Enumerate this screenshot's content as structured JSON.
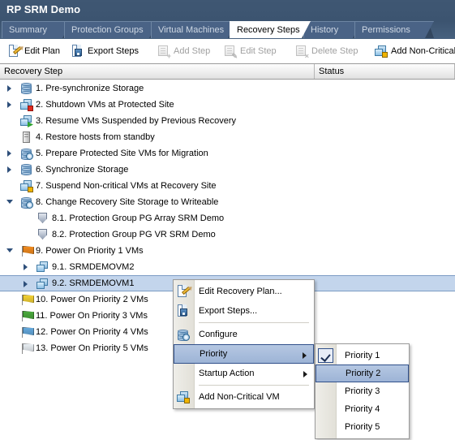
{
  "window": {
    "title": "RP SRM Demo"
  },
  "tabs": [
    {
      "label": "Summary",
      "selected": false
    },
    {
      "label": "Protection Groups",
      "selected": false
    },
    {
      "label": "Virtual Machines",
      "selected": false
    },
    {
      "label": "Recovery Steps",
      "selected": true
    },
    {
      "label": "History",
      "selected": false
    },
    {
      "label": "Permissions",
      "selected": false
    }
  ],
  "toolbar": [
    {
      "label": "Edit Plan",
      "icon": "edit-plan-icon",
      "enabled": true
    },
    {
      "label": "Export Steps",
      "icon": "export-steps-icon",
      "enabled": true
    },
    {
      "label": "Add Step",
      "icon": "add-step-icon",
      "enabled": false
    },
    {
      "label": "Edit Step",
      "icon": "edit-step-icon",
      "enabled": false
    },
    {
      "label": "Delete Step",
      "icon": "delete-step-icon",
      "enabled": false
    },
    {
      "label": "Add Non-Critical",
      "icon": "add-non-critical-icon",
      "enabled": true
    }
  ],
  "columns": [
    {
      "label": "Recovery Step"
    },
    {
      "label": "Status"
    }
  ],
  "rows": [
    {
      "label": "1. Pre-synchronize Storage",
      "indent": 0,
      "twisty": "collapsed",
      "icon": "storage-icon"
    },
    {
      "label": "2. Shutdown VMs at Protected Site",
      "indent": 0,
      "twisty": "collapsed",
      "icon": "vms-stop-icon"
    },
    {
      "label": "3. Resume VMs Suspended by Previous Recovery",
      "indent": 0,
      "twisty": "none",
      "icon": "vms-resume-icon"
    },
    {
      "label": "4. Restore hosts from standby",
      "indent": 0,
      "twisty": "none",
      "icon": "host-icon"
    },
    {
      "label": "5. Prepare Protected Site VMs for Migration",
      "indent": 0,
      "twisty": "collapsed",
      "icon": "storage-config-icon"
    },
    {
      "label": "6. Synchronize Storage",
      "indent": 0,
      "twisty": "collapsed",
      "icon": "storage-icon"
    },
    {
      "label": "7. Suspend Non-critical VMs at Recovery Site",
      "indent": 0,
      "twisty": "none",
      "icon": "vms-suspend-icon"
    },
    {
      "label": "8. Change Recovery Site Storage to Writeable",
      "indent": 0,
      "twisty": "expanded",
      "icon": "storage-config-icon"
    },
    {
      "label": "8.1. Protection Group PG Array SRM Demo",
      "indent": 1,
      "twisty": "none",
      "icon": "shield-icon"
    },
    {
      "label": "8.2. Protection Group PG VR SRM Demo",
      "indent": 1,
      "twisty": "none",
      "icon": "shield-icon"
    },
    {
      "label": "9. Power On Priority 1 VMs",
      "indent": 0,
      "twisty": "expanded",
      "icon": "flag-orange-icon"
    },
    {
      "label": "9.1. SRMDEMOVM2",
      "indent": 1,
      "twisty": "collapsed",
      "icon": "vm-icon"
    },
    {
      "label": "9.2. SRMDEMOVM1",
      "indent": 1,
      "twisty": "collapsed",
      "icon": "vm-icon",
      "selected": true
    },
    {
      "label": "10. Power On Priority 2 VMs",
      "indent": 0,
      "twisty": "none",
      "icon": "flag-yellow-icon"
    },
    {
      "label": "11. Power On Priority 3 VMs",
      "indent": 0,
      "twisty": "none",
      "icon": "flag-green-icon"
    },
    {
      "label": "12. Power On Priority 4 VMs",
      "indent": 0,
      "twisty": "none",
      "icon": "flag-blue-icon"
    },
    {
      "label": "13. Power On Priority 5 VMs",
      "indent": 0,
      "twisty": "none",
      "icon": "flag-white-icon"
    }
  ],
  "context_menu": {
    "items": [
      {
        "label": "Edit Recovery Plan...",
        "icon": "edit-plan-icon",
        "submenu": false,
        "highlighted": false
      },
      {
        "label": "Export Steps...",
        "icon": "export-steps-icon",
        "submenu": false,
        "highlighted": false
      },
      {
        "separator_after": true
      },
      {
        "label": "Configure",
        "icon": "configure-icon",
        "submenu": false,
        "highlighted": false
      },
      {
        "label": "Priority",
        "icon": "",
        "submenu": true,
        "highlighted": true
      },
      {
        "label": "Startup Action",
        "icon": "",
        "submenu": true,
        "highlighted": false
      },
      {
        "separator_after": true
      },
      {
        "label": "Add Non-Critical VM",
        "icon": "add-non-critical-icon",
        "submenu": false,
        "highlighted": false
      }
    ]
  },
  "submenu": {
    "items": [
      {
        "label": "Priority 1",
        "checked": true,
        "highlighted": false
      },
      {
        "label": "Priority 2",
        "checked": false,
        "highlighted": true
      },
      {
        "label": "Priority 3",
        "checked": false,
        "highlighted": false
      },
      {
        "label": "Priority 4",
        "checked": false,
        "highlighted": false
      },
      {
        "label": "Priority 5",
        "checked": false,
        "highlighted": false
      }
    ]
  },
  "colors": {
    "header_bg": "#3f5773",
    "tab_selected_bg": "#ffffff",
    "selection_bg": "#c3d5ec",
    "menu_highlight": "#9db4d6",
    "flag_orange": "#f08a1e",
    "flag_yellow": "#f2d034",
    "flag_green": "#4aa83c",
    "flag_blue": "#64a8dc",
    "flag_white": "#e8edf3"
  }
}
